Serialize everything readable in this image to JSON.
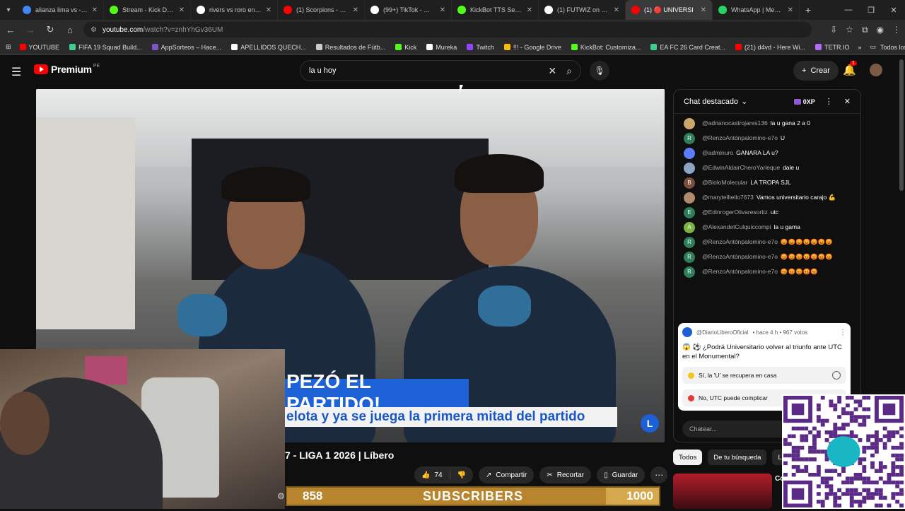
{
  "browser": {
    "tabs": [
      {
        "label": "alianza lima vs - Busc",
        "color": "#4285f4",
        "active": false
      },
      {
        "label": "Stream - Kick Dashbo",
        "color": "#53fc18",
        "active": false
      },
      {
        "label": "rivers vs roro en la ve",
        "color": "#ffffff",
        "active": false
      },
      {
        "label": "(1) Scorpions - Still Li",
        "color": "#ff0000",
        "active": false
      },
      {
        "label": "(99+) TikTok - Make Y",
        "color": "#ffffff",
        "active": false
      },
      {
        "label": "KickBot TTS Settings",
        "color": "#53fc18",
        "active": false
      },
      {
        "label": "(1) FUTWIZ on X: \"@",
        "color": "#ffffff",
        "active": false
      },
      {
        "label": "(1) 🔴 UNIVERSI",
        "color": "#ff0000",
        "active": true
      },
      {
        "label": "WhatsApp | Mensaje",
        "color": "#25d366",
        "active": false
      }
    ],
    "url_site": "youtube.com",
    "url_rest": "/watch?v=znhYhGv36UM",
    "bookmarks": [
      {
        "label": "YOUTUBE",
        "color": "#ff0000"
      },
      {
        "label": "FIFA 19 Squad Build...",
        "color": "#3ecf8e"
      },
      {
        "label": "AppSorteos – Hace...",
        "color": "#7e57c2"
      },
      {
        "label": "APELLIDOS QUECH...",
        "color": "#ffffff"
      },
      {
        "label": "Resultados de Fútb...",
        "color": "#cccccc"
      },
      {
        "label": "Kick",
        "color": "#53fc18"
      },
      {
        "label": "Mureka",
        "color": "#ffffff"
      },
      {
        "label": "Twitch",
        "color": "#9146ff"
      },
      {
        "label": "!!! - Google Drive",
        "color": "#fbbc04"
      },
      {
        "label": "KickBot: Customiza...",
        "color": "#53fc18"
      },
      {
        "label": "EA FC 26 Card Creat...",
        "color": "#3ecf8e"
      },
      {
        "label": "(21) d4vd - Here Wi...",
        "color": "#ff0000"
      },
      {
        "label": "TETR.IO",
        "color": "#b36bff"
      }
    ],
    "all_bookmarks": "Todos los marcadores"
  },
  "youtube": {
    "logo_text": "Premium",
    "logo_region": "PE",
    "search_value": "la u hoy",
    "create_label": "Crear",
    "notif_count": "1"
  },
  "video": {
    "banner_main": "PEZÓ EL PARTIDO!",
    "banner_sub": "elota y ya se juega la primera mitad del partido",
    "title": "7 - LIGA 1 2026 | Líbero",
    "likes": "74",
    "share": "Compartir",
    "clip": "Recortar",
    "save": "Guardar"
  },
  "overlay": {
    "subs_current": "858",
    "subs_label": "SUBSCRIBERS",
    "subs_goal": "1000",
    "subs_progress": 0.858
  },
  "chat": {
    "title": "Chat destacado",
    "xp": "0XP",
    "messages": [
      {
        "user": "@adrianocastrojares136",
        "text": "la u gana 2 a 0",
        "avatar": "#c9a86a",
        "initial": ""
      },
      {
        "user": "@RenzoAntónpalomino-e7o",
        "text": "U",
        "avatar": "#2e7d5b",
        "initial": "R"
      },
      {
        "user": "@adminuro",
        "text": "GANARA LA u?",
        "avatar": "#5c7cfa",
        "initial": ""
      },
      {
        "user": "@EdwinAldairCheroYarleque",
        "text": "dale u",
        "avatar": "#8fa3c2",
        "initial": ""
      },
      {
        "user": "@BioloMolecular",
        "text": "LA TROPA SJL",
        "avatar": "#7a4e3d",
        "initial": "B"
      },
      {
        "user": "@marytelltello7673",
        "text": "Vamos universitario carajo 💪",
        "avatar": "#b08a6d",
        "initial": ""
      },
      {
        "user": "@EdinrogerOlivaresortiz",
        "text": "utc",
        "avatar": "#2e7d5b",
        "initial": "E"
      },
      {
        "user": "@AlexandetCulquiccompi",
        "text": "la u gama",
        "avatar": "#7cb342",
        "initial": "A"
      },
      {
        "user": "@RenzoAntónpalomino-e7o",
        "text": "😡😡😡😡😡😡😡",
        "avatar": "#2e7d5b",
        "initial": "R"
      },
      {
        "user": "@RenzoAntónpalomino-e7o",
        "text": "😡😡😡😡😡😡😡",
        "avatar": "#2e7d5b",
        "initial": "R"
      },
      {
        "user": "@RenzoAntónpalomino-e7o",
        "text": "😡😡😡😡😡",
        "avatar": "#2e7d5b",
        "initial": "R"
      }
    ],
    "poll": {
      "author": "@DiarioLiberoOficial",
      "meta": "• hace 4 h • 967 votos",
      "question": "😱 ⚽ ¿Podrá Universitario volver al triunfo ante UTC en el Monumental?",
      "options": [
        {
          "label": "Sí, la 'U' se recupera en casa",
          "dot": "#f5c518"
        },
        {
          "label": "No, UTC puede complicar",
          "dot": "#e53935"
        }
      ]
    },
    "input_placeholder": "Chatear..."
  },
  "filters": [
    "Todos",
    "De tu búsqueda",
    "Líb"
  ],
  "suggestion_title": "Comerci"
}
